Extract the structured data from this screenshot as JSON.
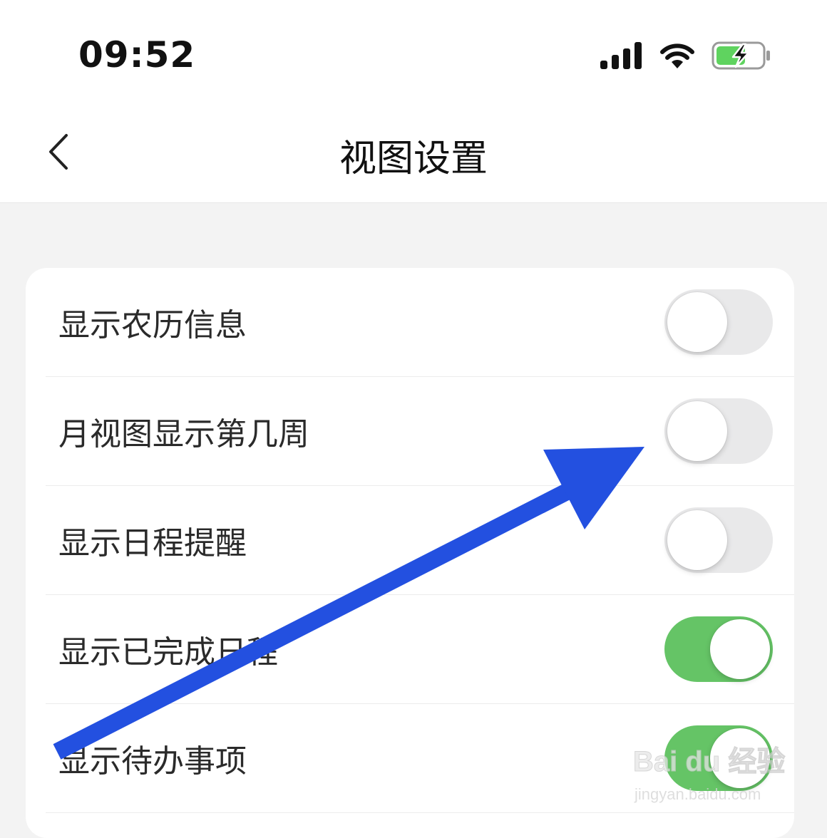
{
  "status_bar": {
    "time": "09:52",
    "icons": [
      "cellular-signal-icon",
      "wifi-icon",
      "battery-charging-icon"
    ],
    "battery_color": "#5fd35f"
  },
  "nav": {
    "back_icon": "chevron-left-icon",
    "title": "视图设置"
  },
  "settings": [
    {
      "label": "显示农历信息",
      "enabled": false
    },
    {
      "label": "月视图显示第几周",
      "enabled": false
    },
    {
      "label": "显示日程提醒",
      "enabled": false
    },
    {
      "label": "显示已完成日程",
      "enabled": true
    },
    {
      "label": "显示待办事项",
      "enabled": true
    }
  ],
  "colors": {
    "toggle_on": "#65c466",
    "toggle_off": "#e9e9ea",
    "annotation_arrow": "#2350e0"
  },
  "watermark": {
    "logo_text": "Bai du 经验",
    "url_text": "jingyan.baidu.com"
  }
}
